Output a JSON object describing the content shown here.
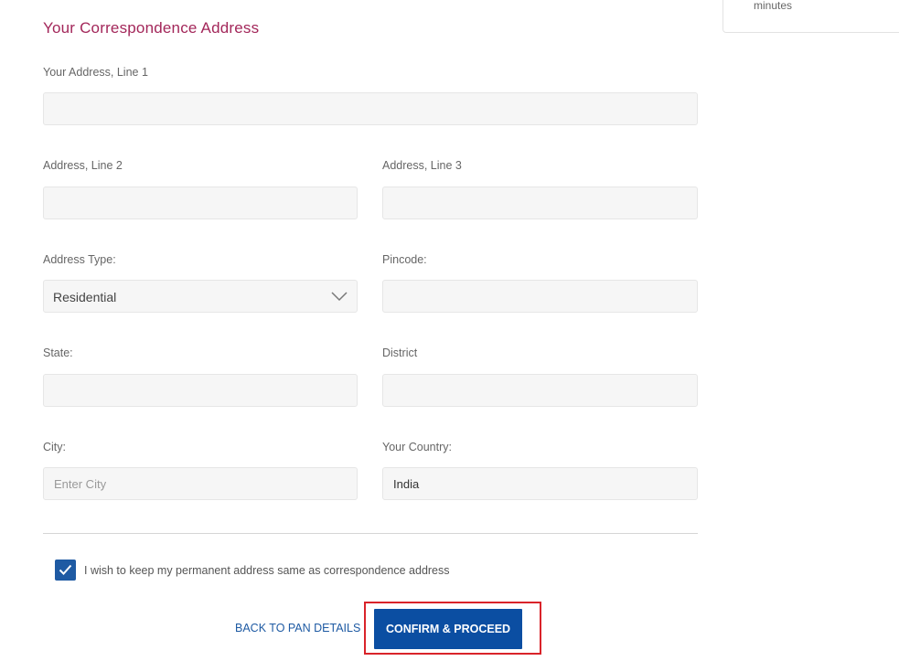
{
  "side_card": {
    "text": "minutes"
  },
  "section_title": "Your Correspondence Address",
  "fields": {
    "address_line1": {
      "label": "Your Address, Line 1",
      "value": "",
      "placeholder": ""
    },
    "address_line2": {
      "label": "Address, Line 2",
      "value": "",
      "placeholder": ""
    },
    "address_line3": {
      "label": "Address, Line 3",
      "value": "",
      "placeholder": ""
    },
    "address_type": {
      "label": "Address Type:",
      "selected": "Residential"
    },
    "pincode": {
      "label": "Pincode:",
      "value": "",
      "placeholder": ""
    },
    "state": {
      "label": "State:",
      "value": "",
      "placeholder": ""
    },
    "district": {
      "label": "District",
      "value": "",
      "placeholder": ""
    },
    "city": {
      "label": "City:",
      "value": "",
      "placeholder": "Enter City"
    },
    "country": {
      "label": "Your Country:",
      "value": "India",
      "placeholder": ""
    }
  },
  "checkbox": {
    "checked": true,
    "label": "I wish to keep my permanent address same as correspondence address"
  },
  "actions": {
    "back_label": "BACK TO PAN DETAILS",
    "confirm_label": "CONFIRM & PROCEED"
  },
  "colors": {
    "title": "#a3275a",
    "primary": "#0b4ea2",
    "link": "#1e5aa3",
    "highlight": "#d9232a"
  },
  "icons": {
    "dropdown": "chevron-down-icon",
    "checkbox": "checkmark-icon"
  }
}
